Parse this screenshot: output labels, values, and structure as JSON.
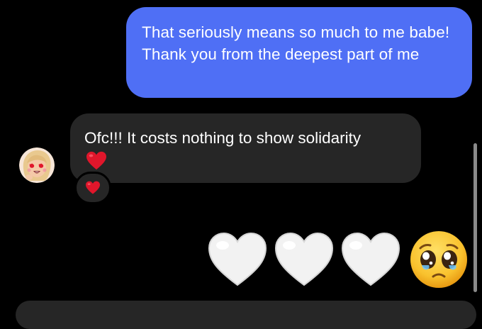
{
  "messages": {
    "outgoing_1": {
      "text": "That seriously means so much to me babe! Thank you from the deepest part of me"
    },
    "incoming_1": {
      "text": "Ofc!!! It costs nothing to show solidarity",
      "inline_emoji": "red-heart",
      "reaction": "red-heart"
    },
    "outgoing_2": {
      "emojis": [
        "white-heart",
        "white-heart",
        "white-heart",
        "pleading-face"
      ]
    }
  },
  "colors": {
    "outgoing_bubble": "#4f6ff5",
    "incoming_bubble": "#262626",
    "background": "#000000",
    "heart_red": "#e0162b",
    "scrollbar": "#8a8a8a"
  }
}
